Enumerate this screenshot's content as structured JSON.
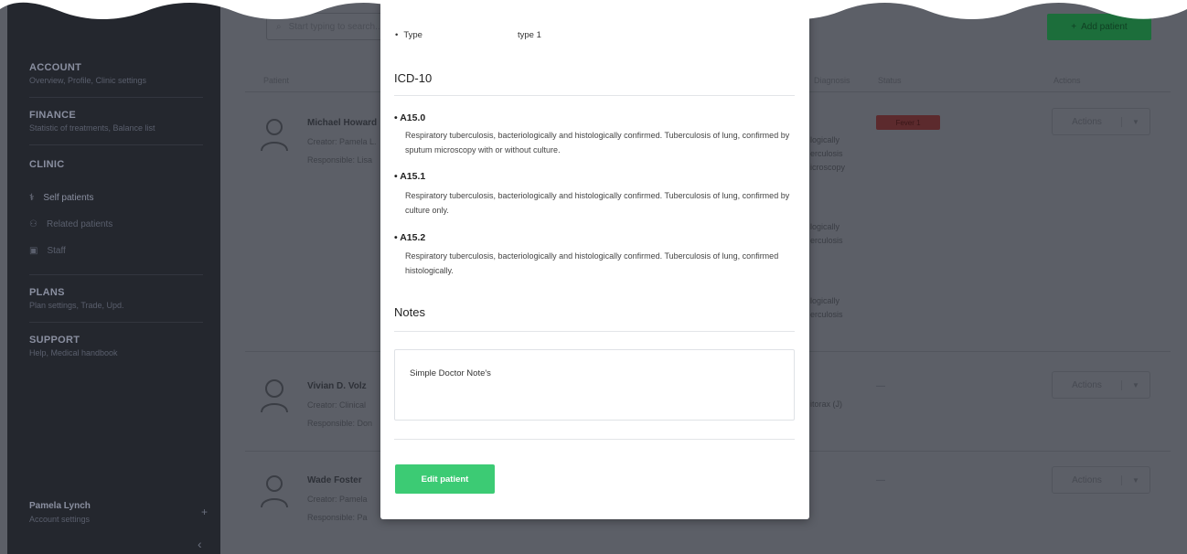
{
  "sidebar": {
    "sections": [
      {
        "title": "ACCOUNT",
        "subtitle": "Overview, Profile, Clinic settings"
      },
      {
        "title": "FINANCE",
        "subtitle": "Statistic of treatments, Balance list"
      },
      {
        "title": "CLINIC",
        "subtitle": ""
      },
      {
        "title": "PLANS",
        "subtitle": "Plan settings, Trade, Upd."
      },
      {
        "title": "SUPPORT",
        "subtitle": "Help, Medical handbook"
      }
    ],
    "items": [
      {
        "label": "Self patients"
      },
      {
        "label": "Related patients"
      },
      {
        "label": "Staff"
      }
    ],
    "user": {
      "name": "Pamela Lynch",
      "subtitle": "Account settings"
    }
  },
  "toolbar": {
    "search_placeholder": "Start typing to search...",
    "add_label": "Add patient"
  },
  "table": {
    "headers": [
      "Patient",
      "Diagnosis",
      "Status",
      "Actions"
    ],
    "rows": [
      {
        "name": "Michael Howard",
        "line1": "Creator: Pamela L.",
        "line2": "Responsible: Lisa",
        "frags": [
          "logically",
          "erculosis",
          "icroscopy",
          "logically",
          "erculosis",
          "logically",
          "erculosis"
        ],
        "status": "Fever 1",
        "actions": "Actions"
      },
      {
        "name": "Vivian D. Volz",
        "line1": "Creator: Clinical",
        "line2": "Responsible: Don",
        "frags": [
          "itorax (J)"
        ],
        "status": "—",
        "actions": "Actions"
      },
      {
        "name": "Wade Foster",
        "line1": "Creator: Pamela",
        "line2": "Responsible: Pa",
        "frags": [],
        "status": "—",
        "actions": "Actions"
      }
    ]
  },
  "modal": {
    "type_label": "Type",
    "type_value": "type 1",
    "icd_heading": "ICD-10",
    "codes": [
      {
        "code": "A15.0",
        "description": "Respiratory tuberculosis, bacteriologically and histologically confirmed. Tuberculosis of lung, confirmed by sputum microscopy with or without culture."
      },
      {
        "code": "A15.1",
        "description": "Respiratory tuberculosis, bacteriologically and histologically confirmed. Tuberculosis of lung, confirmed by culture only."
      },
      {
        "code": "A15.2",
        "description": "Respiratory tuberculosis, bacteriologically and histologically confirmed. Tuberculosis of lung, confirmed histologically."
      }
    ],
    "notes_heading": "Notes",
    "notes_text": "Simple Doctor Note's",
    "edit_button": "Edit patient"
  },
  "colors": {
    "accent_green": "#3ccb74",
    "overlay_bg": "#5c5f67",
    "sidebar_bg": "#24272e"
  }
}
